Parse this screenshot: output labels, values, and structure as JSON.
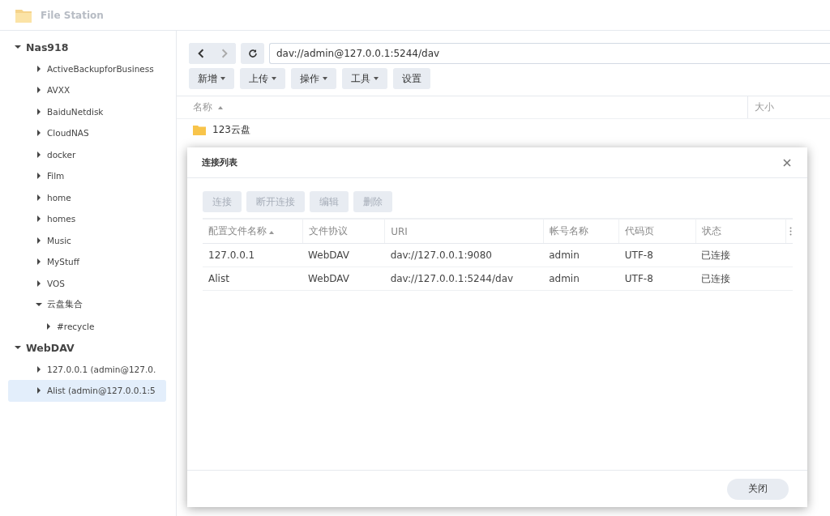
{
  "window": {
    "title": "File Station"
  },
  "tree": [
    {
      "label": "Nas918",
      "expanded": true,
      "selected": false,
      "children": [
        {
          "label": "ActiveBackupforBusiness",
          "expanded": false,
          "selected": false
        },
        {
          "label": "AVXX",
          "expanded": false,
          "selected": false
        },
        {
          "label": "BaiduNetdisk",
          "expanded": false,
          "selected": false
        },
        {
          "label": "CloudNAS",
          "expanded": false,
          "selected": false
        },
        {
          "label": "docker",
          "expanded": false,
          "selected": false
        },
        {
          "label": "Film",
          "expanded": false,
          "selected": false
        },
        {
          "label": "home",
          "expanded": false,
          "selected": false
        },
        {
          "label": "homes",
          "expanded": false,
          "selected": false
        },
        {
          "label": "Music",
          "expanded": false,
          "selected": false
        },
        {
          "label": "MyStuff",
          "expanded": false,
          "selected": false
        },
        {
          "label": "VOS",
          "expanded": false,
          "selected": false
        },
        {
          "label": "云盘集合",
          "expanded": true,
          "selected": false,
          "children": [
            {
              "label": "#recycle",
              "expanded": false,
              "selected": false
            }
          ]
        }
      ]
    },
    {
      "label": "WebDAV",
      "expanded": true,
      "selected": false,
      "children": [
        {
          "label": "127.0.0.1 (admin@127.0.",
          "expanded": false,
          "selected": false
        },
        {
          "label": "Alist (admin@127.0.0.1:5",
          "expanded": false,
          "selected": true
        }
      ]
    }
  ],
  "path": "dav://admin@127.0.0.1:5244/dav",
  "toolbar": [
    {
      "label": "新增",
      "dropdown": true
    },
    {
      "label": "上传",
      "dropdown": true
    },
    {
      "label": "操作",
      "dropdown": true
    },
    {
      "label": "工具",
      "dropdown": true
    },
    {
      "label": "设置",
      "dropdown": false
    }
  ],
  "file_list": {
    "columns": [
      {
        "label": "名称",
        "sorted": true
      },
      {
        "label": "大小",
        "sorted": false
      }
    ],
    "rows": [
      {
        "name": "123云盘"
      }
    ]
  },
  "dialog": {
    "title": "连接列表",
    "buttons": [
      {
        "label": "连接",
        "disabled": true
      },
      {
        "label": "断开连接",
        "disabled": true
      },
      {
        "label": "编辑",
        "disabled": true
      },
      {
        "label": "删除",
        "disabled": true
      }
    ],
    "columns": [
      {
        "label": "配置文件名称",
        "sorted": true
      },
      {
        "label": "文件协议",
        "sorted": false
      },
      {
        "label": "URI",
        "sorted": false
      },
      {
        "label": "帐号名称",
        "sorted": false
      },
      {
        "label": "代码页",
        "sorted": false
      },
      {
        "label": "状态",
        "sorted": false
      }
    ],
    "rows": [
      [
        "127.0.0.1",
        "WebDAV",
        "dav://127.0.0.1:9080",
        "admin",
        "UTF-8",
        "已连接"
      ],
      [
        "Alist",
        "WebDAV",
        "dav://127.0.0.1:5244/dav",
        "admin",
        "UTF-8",
        "已连接"
      ]
    ],
    "close_button": "关闭"
  }
}
